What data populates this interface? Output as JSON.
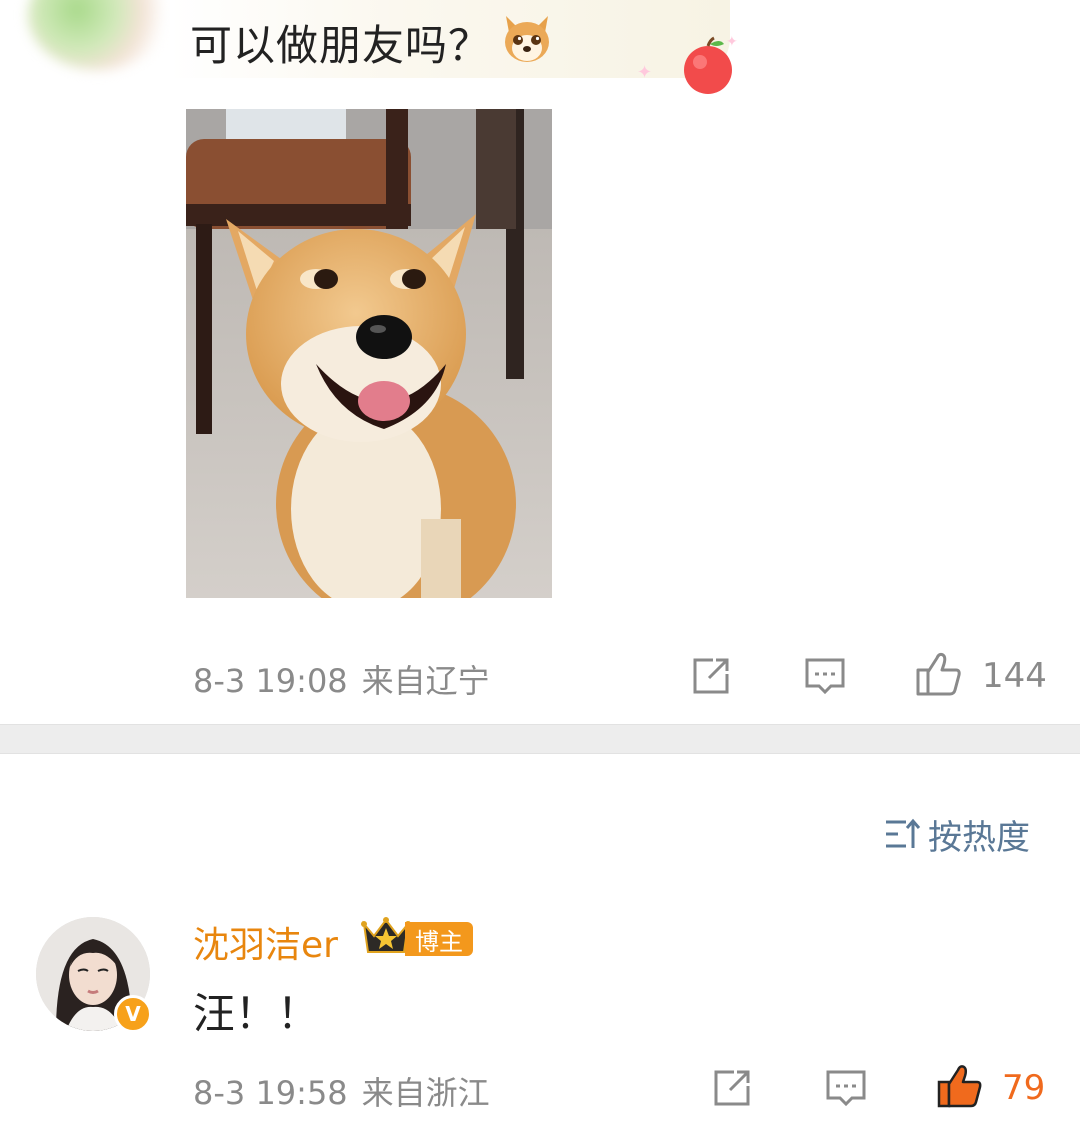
{
  "post": {
    "text": "可以做朋友吗？",
    "emoji": "shiba-dog-emoji",
    "sticker": "apple-sticker",
    "photo": "shiba-inu-photo",
    "timestamp": "8-3 19:08",
    "location": "来自辽宁",
    "like_count": "144"
  },
  "sort": {
    "label": "按热度",
    "icon": "sort-icon"
  },
  "comment": {
    "username": "沈羽洁er",
    "tag": "博主",
    "verified_badge": "V",
    "text": "汪！！",
    "timestamp": "8-3 19:58",
    "location": "来自浙江",
    "like_count": "79"
  },
  "colors": {
    "username": "#e8860e",
    "liked": "#f06a1d",
    "meta": "#8a8a8a",
    "sort": "#5a7896",
    "divider": "#ededed"
  }
}
